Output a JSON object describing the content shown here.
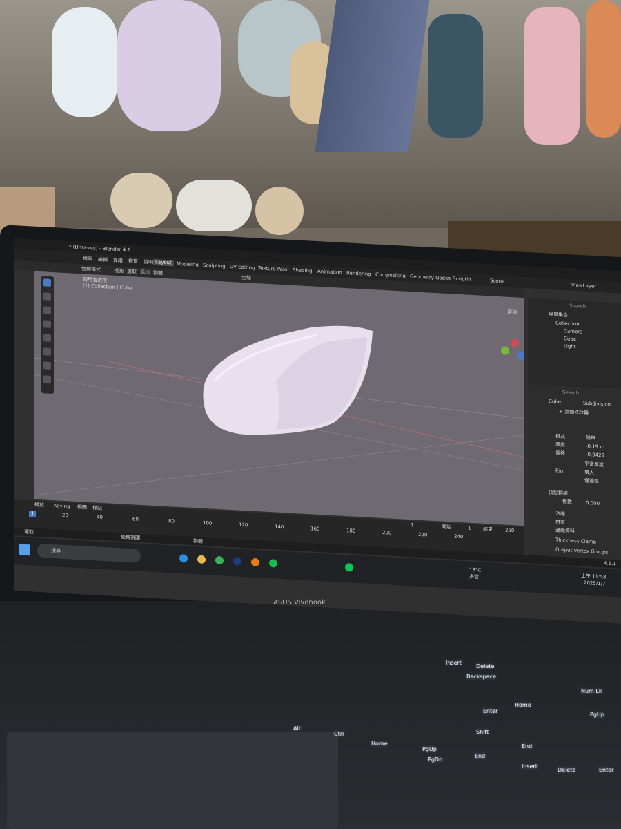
{
  "blender": {
    "title": "* (Unsaved) - Blender 4.1",
    "menu": [
      "檔案",
      "編輯",
      "算繪",
      "視窗",
      "說明"
    ],
    "workspaces": [
      "Layout",
      "Modeling",
      "Sculpting",
      "UV Editing",
      "Texture Paint",
      "Shading",
      "Animation",
      "Rendering",
      "Compositing",
      "Geometry Nodes",
      "Scriptin"
    ],
    "scene_name": "Scene",
    "viewlayer_name": "ViewLayer",
    "header": {
      "mode": "物體模式",
      "view": "視圖",
      "select": "選取",
      "add": "添加",
      "object": "物體",
      "transform": "全域"
    },
    "viewport": {
      "line1": "使用者透視",
      "line2": "(1) Collection | Cube",
      "options": "選項"
    },
    "outliner": {
      "search_placeholder": "Search",
      "root": "場景集合",
      "collection": "Collection",
      "items": [
        "Camera",
        "Cube",
        "Light"
      ]
    },
    "properties": {
      "search_placeholder": "Search",
      "breadcrumb_object": "Cube",
      "breadcrumb_modifier": "Subdivision",
      "add_modifier": "+ 添加修改器",
      "fields": [
        {
          "label": "模式",
          "value": "簡單"
        },
        {
          "label": "厚度",
          "value": "-0.19 m"
        },
        {
          "label": "偏移",
          "value": "-0.9429"
        }
      ],
      "checkbox_even": "平滑厚度",
      "rim_label": "Rim",
      "rim_fill": "填入",
      "rim_only": "僅邊框",
      "vertex_group_label": "頂點群組",
      "factor_label": "係數",
      "factor_value": "0.000",
      "panels": [
        "法線",
        "材質",
        "邊緣資料",
        "Thickness Clamp",
        "Output Vertex Groups"
      ]
    },
    "timeline": {
      "playback": "播放",
      "keying": "Keying",
      "view": "視圖",
      "marker": "標記",
      "current_frame": "1",
      "start_label": "開始",
      "start_value": "1",
      "end_label": "結束",
      "end_value": "250",
      "ticks": [
        "20",
        "40",
        "60",
        "80",
        "100",
        "120",
        "140",
        "160",
        "180",
        "200",
        "220",
        "240"
      ],
      "frame_marker": "1"
    },
    "status": {
      "left": "選取",
      "middle": "旋轉視圖",
      "right": "物體",
      "version": "4.1.1"
    }
  },
  "taskbar": {
    "search_placeholder": "搜尋",
    "weather_temp": "18°C",
    "weather_text": "多雲",
    "time": "上午 11:58",
    "date": "2025/1/7"
  },
  "laptop": {
    "brand": "ASUS Vivobook"
  },
  "keyboard": {
    "labels": [
      "Insert",
      "Delete",
      "Backspace",
      "Num Lk",
      "Enter",
      "Home",
      "PgUp",
      "Shift",
      "Alt",
      "Ctrl",
      "Home",
      "PgUp",
      "End",
      "PgDn",
      "Insert",
      "Delete",
      "Enter",
      "End"
    ]
  },
  "colors": {
    "blender_bg": "#3d3d3d",
    "viewport_bg": "#6d6870",
    "accent_blue": "#4a7bc8",
    "object_color": "#e9e0ee"
  }
}
